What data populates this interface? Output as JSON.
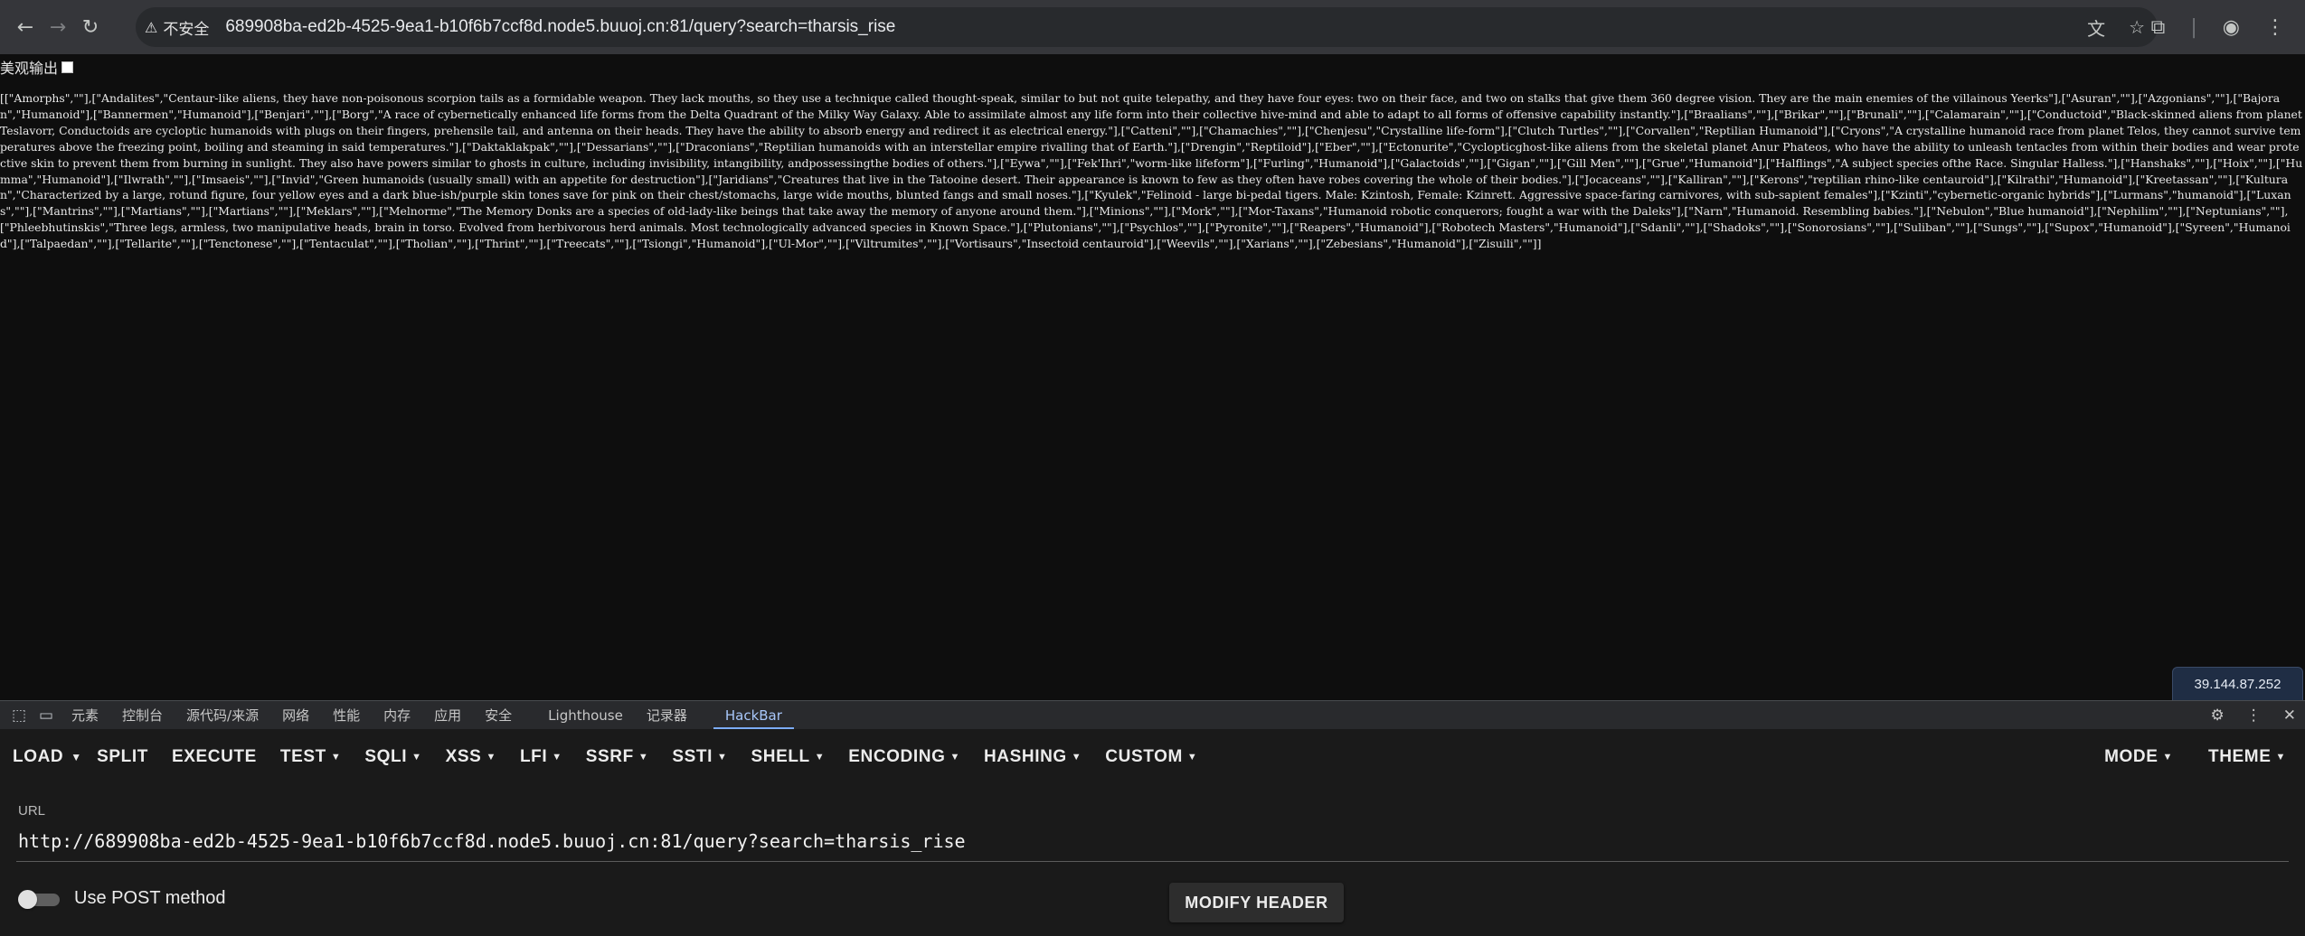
{
  "browser": {
    "insecure_label": "不安全",
    "address": "689908ba-ed2b-4525-9ea1-b10f6b7ccf8d.node5.buuoj.cn:81/query?search=tharsis_rise"
  },
  "page": {
    "pretty_print_label": "美观输出",
    "json_output": "[[\"Amorphs\",\"\"],[\"Andalites\",\"Centaur-like aliens, they have non-poisonous scorpion tails as a formidable weapon. They lack mouths, so they use a technique called thought-speak, similar to but not quite telepathy, and they have four eyes: two on their face, and two on stalks that give them 360 degree vision. They are the main enemies of the villainous Yeerks\"],[\"Asuran\",\"\"],[\"Azgonians\",\"\"],[\"Bajoran\",\"Humanoid\"],[\"Bannermen\",\"Humanoid\"],[\"Benjari\",\"\"],[\"Borg\",\"A race of cybernetically enhanced life forms from the Delta Quadrant of the Milky Way Galaxy. Able to assimilate almost any life form into their collective hive-mind and able to adapt to all forms of offensive capability instantly.\"],[\"Braalians\",\"\"],[\"Brikar\",\"\"],[\"Brunali\",\"\"],[\"Calamarain\",\"\"],[\"Conductoid\",\"Black-skinned aliens from planet Teslavorr, Conductoids are cycloptic humanoids with plugs on their fingers, prehensile tail, and antenna on their heads. They have the ability to absorb energy and redirect it as electrical energy.\"],[\"Catteni\",\"\"],[\"Chamachies\",\"\"],[\"Chenjesu\",\"Crystalline life-form\"],[\"Clutch Turtles\",\"\"],[\"Corvallen\",\"Reptilian Humanoid\"],[\"Cryons\",\"A crystalline humanoid race from planet Telos, they cannot survive temperatures above the freezing point, boiling and steaming in said temperatures.\"],[\"Daktaklakpak\",\"\"],[\"Dessarians\",\"\"],[\"Draconians\",\"Reptilian humanoids with an interstellar empire rivalling that of Earth.\"],[\"Drengin\",\"Reptiloid\"],[\"Eber\",\"\"],[\"Ectonurite\",\"Cyclopticghost-like aliens from the skeletal planet Anur Phateos, who have the ability to unleash tentacles from within their bodies and wear protective skin to prevent them from burning in sunlight. They also have powers similar to ghosts in culture, including invisibility, intangibility, andpossessingthe bodies of others.\"],[\"Eywa\",\"\"],[\"Fek'Ihri\",\"worm-like lifeform\"],[\"Furling\",\"Humanoid\"],[\"Galactoids\",\"\"],[\"Gigan\",\"\"],[\"Gill Men\",\"\"],[\"Grue\",\"Humanoid\"],[\"Halflings\",\"A subject species ofthe Race. Singular Halless.\"],[\"Hanshaks\",\"\"],[\"Hoix\",\"\"],[\"Humma\",\"Humanoid\"],[\"Ilwrath\",\"\"],[\"Imsaeis\",\"\"],[\"Invid\",\"Green humanoids (usually small) with an appetite for destruction\"],[\"Jaridians\",\"Creatures that live in the Tatooine desert. Their appearance is known to few as they often have robes covering the whole of their bodies.\"],[\"Jocaceans\",\"\"],[\"Kalliran\",\"\"],[\"Kerons\",\"reptilian rhino-like centauroid\"],[\"Kilrathi\",\"Humanoid\"],[\"Kreetassan\",\"\"],[\"Kulturan\",\"Characterized by a large, rotund figure, four yellow eyes and a dark blue-ish/purple skin tones save for pink on their chest/stomachs, large wide mouths, blunted fangs and small noses.\"],[\"Kyulek\",\"Felinoid - large bi-pedal tigers. Male: Kzintosh, Female: Kzinrett. Aggressive space-faring carnivores, with sub-sapient females\"],[\"Kzinti\",\"cybernetic-organic hybrids\"],[\"Lurmans\",\"humanoid\"],[\"Luxans\",\"\"],[\"Mantrins\",\"\"],[\"Martians\",\"\"],[\"Martians\",\"\"],[\"Meklars\",\"\"],[\"Melnorme\",\"The Memory Donks are a species of old-lady-like beings that take away the memory of anyone around them.\"],[\"Minions\",\"\"],[\"Mork\",\"\"],[\"Mor-Taxans\",\"Humanoid robotic conquerors; fought a war with the Daleks\"],[\"Narn\",\"Humanoid. Resembling babies.\"],[\"Nebulon\",\"Blue humanoid\"],[\"Nephilim\",\"\"],[\"Neptunians\",\"\"],[\"Phleebhutinskis\",\"Three legs, armless, two manipulative heads, brain in torso. Evolved from herbivorous herd animals. Most technologically advanced species in Known Space.\"],[\"Plutonians\",\"\"],[\"Psychlos\",\"\"],[\"Pyronite\",\"\"],[\"Reapers\",\"Humanoid\"],[\"Robotech Masters\",\"Humanoid\"],[\"Sdanli\",\"\"],[\"Shadoks\",\"\"],[\"Sonorosians\",\"\"],[\"Suliban\",\"\"],[\"Sungs\",\"\"],[\"Supox\",\"Humanoid\"],[\"Syreen\",\"Humanoid\"],[\"Talpaedan\",\"\"],[\"Tellarite\",\"\"],[\"Tenctonese\",\"\"],[\"Tentaculat\",\"\"],[\"Tholian\",\"\"],[\"Thrint\",\"\"],[\"Treecats\",\"\"],[\"Tsiongi\",\"Humanoid\"],[\"Ul-Mor\",\"\"],[\"Viltrumites\",\"\"],[\"Vortisaurs\",\"Insectoid centauroid\"],[\"Weevils\",\"\"],[\"Xarians\",\"\"],[\"Zebesians\",\"Humanoid\"],[\"Zisuili\",\"\"]]",
    "ip_badge": "39.144.87.252"
  },
  "devtools": {
    "tabs": [
      "元素",
      "控制台",
      "源代码/来源",
      "网络",
      "性能",
      "内存",
      "应用",
      "安全",
      "Lighthouse",
      "记录器",
      "HackBar"
    ],
    "active_tab": "HackBar"
  },
  "hackbar": {
    "menu": {
      "load": "LOAD",
      "split": "SPLIT",
      "execute": "EXECUTE",
      "test": "TEST",
      "sqli": "SQLI",
      "xss": "XSS",
      "lfi": "LFI",
      "ssrf": "SSRF",
      "ssti": "SSTI",
      "shell": "SHELL",
      "encoding": "ENCODING",
      "hashing": "HASHING",
      "custom": "CUSTOM",
      "mode": "MODE",
      "theme": "THEME"
    },
    "url_label": "URL",
    "url_value": "http://689908ba-ed2b-4525-9ea1-b10f6b7ccf8d.node5.buuoj.cn:81/query?search=tharsis_rise",
    "post_label": "Use POST method",
    "post_enabled": false,
    "modify_header": "MODIFY HEADER"
  },
  "colors": {
    "chrome_bg": "#35363a",
    "page_bg": "#0e0e0e",
    "hackbar_bg": "#1a1a1a",
    "accent": "#7cacf8"
  }
}
